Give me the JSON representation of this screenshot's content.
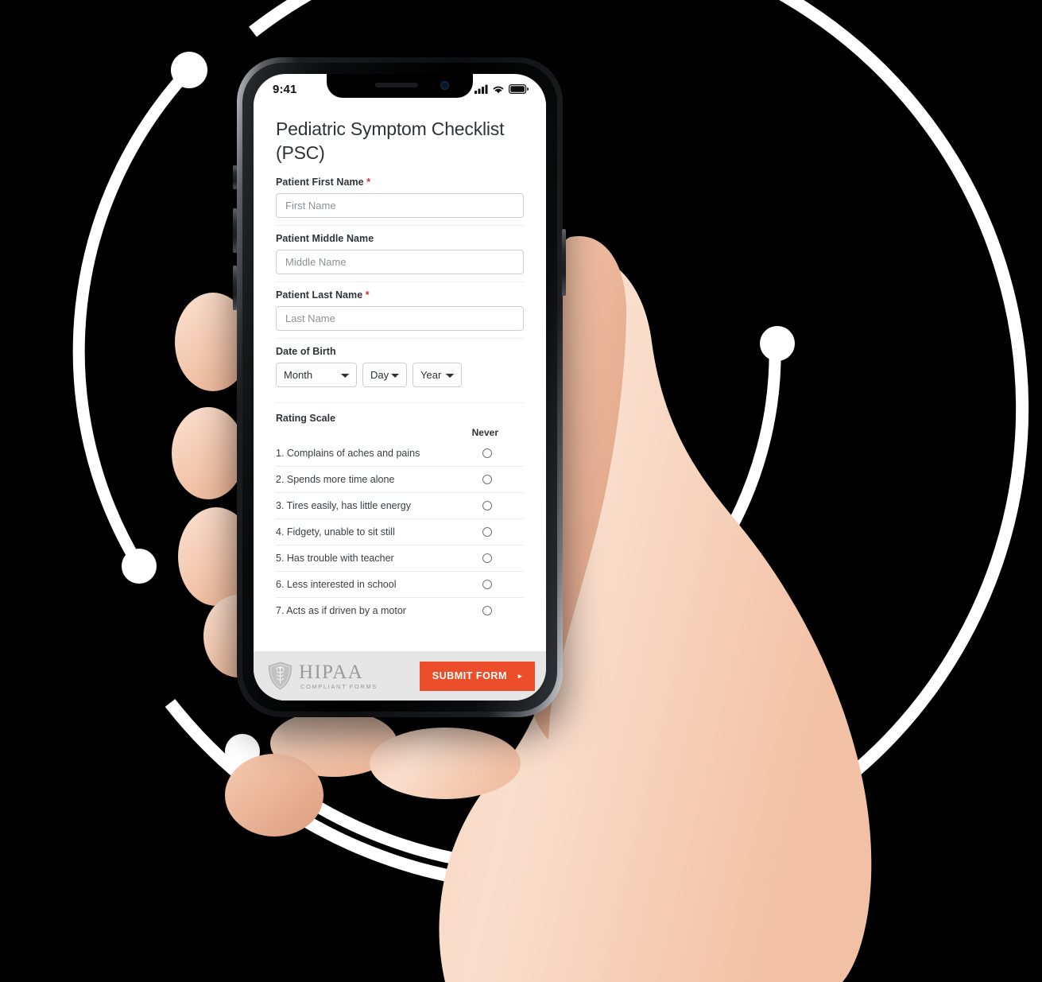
{
  "status_bar": {
    "time": "9:41",
    "cellular_icon": "signal-bars-icon",
    "wifi_icon": "wifi-icon",
    "battery_icon": "battery-full-icon"
  },
  "form": {
    "title": "Pediatric Symptom Checklist (PSC)",
    "fields": [
      {
        "label": "Patient First Name",
        "required": true,
        "required_marker": "*",
        "placeholder": "First Name",
        "value": ""
      },
      {
        "label": "Patient Middle Name",
        "required": false,
        "required_marker": "",
        "placeholder": "Middle Name",
        "value": ""
      },
      {
        "label": "Patient Last Name",
        "required": true,
        "required_marker": "*",
        "placeholder": "Last Name",
        "value": ""
      }
    ],
    "date_of_birth": {
      "label": "Date of Birth",
      "month_selected": "Month",
      "day_selected": "Day",
      "year_selected": "Year"
    },
    "rating_scale": {
      "title": "Rating Scale",
      "columns": [
        "Never"
      ],
      "items": [
        "1. Complains of aches and pains",
        "2. Spends more time alone",
        "3. Tires easily, has little energy",
        "4. Fidgety, unable to sit still",
        "5. Has trouble with teacher",
        "6. Less interested in school",
        "7. Acts as if driven by a motor"
      ]
    }
  },
  "footer": {
    "hipaa_main": "HIPAA",
    "hipaa_sub": "COMPLIANT FORMS",
    "hipaa_icon": "shield-caduceus-icon",
    "submit_label": "SUBMIT FORM",
    "submit_arrow": "▸"
  },
  "colors": {
    "accent_orange": "#ec4d2b",
    "required_red": "#d93025",
    "footer_bg": "#e6e6e6",
    "page_bg": "#000000",
    "decor_white": "#ffffff"
  }
}
